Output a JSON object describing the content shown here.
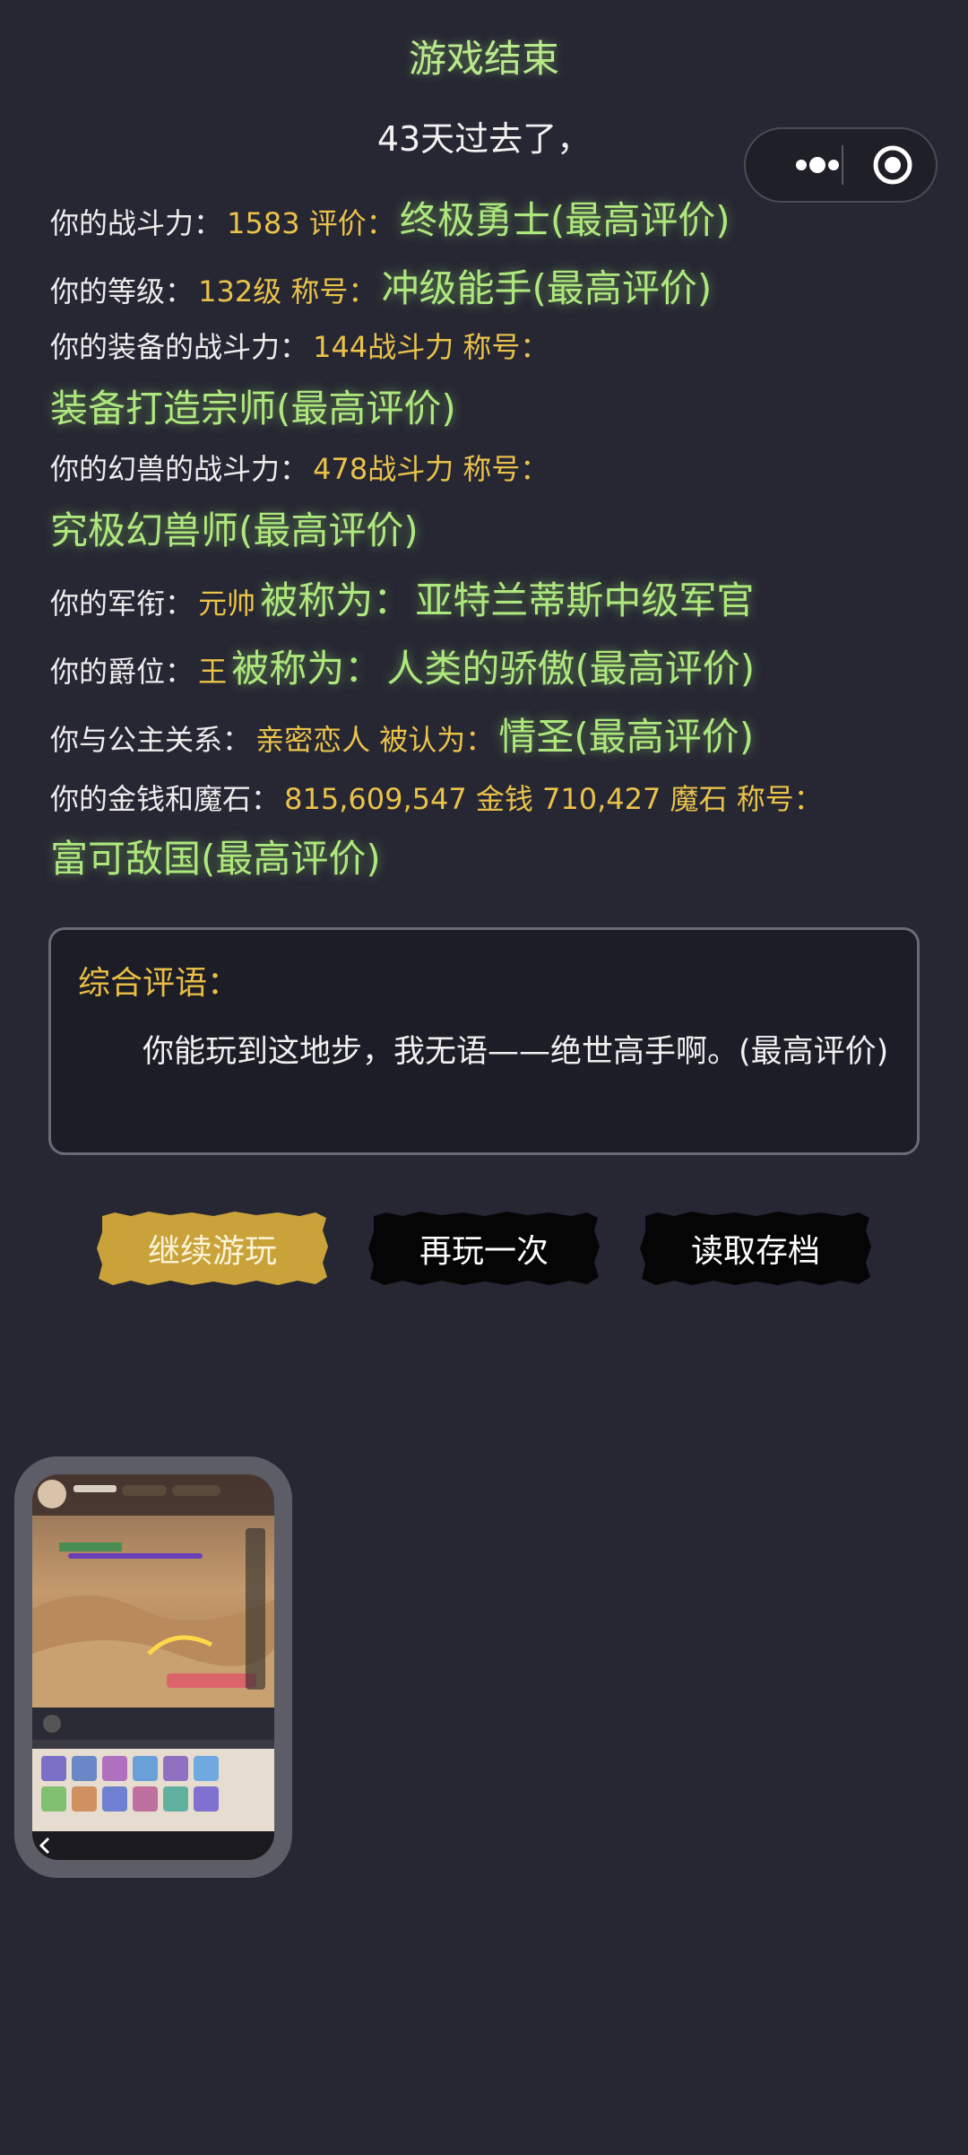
{
  "header": {
    "title": "游戏结束",
    "subtitle": "43天过去了，"
  },
  "stats": {
    "power": {
      "label": "你的战斗力：",
      "value": "1583 评价：",
      "rating": "终极勇士(最高评价)"
    },
    "level": {
      "label": "你的等级：",
      "value": "132级 称号：",
      "rating": "冲级能手(最高评价)"
    },
    "equipment": {
      "label": "你的装备的战斗力：",
      "value": "144战斗力 称号：",
      "rating": "装备打造宗师(最高评价)"
    },
    "beast": {
      "label": "你的幻兽的战斗力：",
      "value": "478战斗力 称号：",
      "rating": "究极幻兽师(最高评价)"
    },
    "rank": {
      "label": "你的军衔：",
      "value": "元帅",
      "mid": "被称为：",
      "rating": "亚特兰蒂斯中级军官"
    },
    "nobility": {
      "label": "你的爵位：",
      "value": "王",
      "mid": "被称为：",
      "rating": "人类的骄傲(最高评价)"
    },
    "princess": {
      "label": "你与公主关系：",
      "value": "亲密恋人 被认为：",
      "rating": "情圣(最高评价)"
    },
    "wealth": {
      "label": "你的金钱和魔石：",
      "value": "815,609,547 金钱 710,427 魔石 称号：",
      "rating": "富可敌国(最高评价)"
    }
  },
  "summary": {
    "title": "综合评语：",
    "body": "你能玩到这地步，我无语——绝世高手啊。(最高评价)"
  },
  "buttons": {
    "continue": "继续游玩",
    "replay": "再玩一次",
    "load": "读取存档"
  },
  "icons": {
    "more": "more-dots-icon",
    "close": "mini-program-close-icon"
  },
  "colors": {
    "background": "#262733",
    "highlight": "#aee77e",
    "value": "#eac24a",
    "button_gold": "#c9a23a"
  }
}
